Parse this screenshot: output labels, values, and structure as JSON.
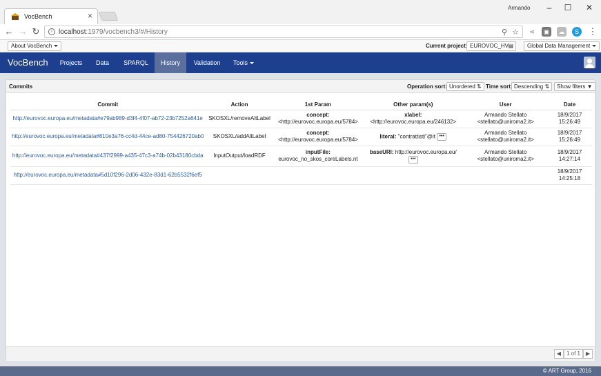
{
  "browser": {
    "tab_title": "VocBench",
    "user": "Armando",
    "url_host": "localhost",
    "url_rest": ":1979/vocbench3/#/History"
  },
  "vbbar": {
    "about": "About VocBench",
    "current_project_label": "Current project:",
    "current_project": "EUROVOC_HV",
    "global_data": "Global Data Management"
  },
  "nav": {
    "brand": "VocBench",
    "items": [
      "Projects",
      "Data",
      "SPARQL",
      "History",
      "Validation",
      "Tools"
    ],
    "active": "History"
  },
  "panel": {
    "title": "Commits",
    "operation_sort_label": "Operation sort:",
    "operation_sort": "Unordered",
    "time_sort_label": "Time sort:",
    "time_sort": "Descending",
    "show_filters": "Show filters"
  },
  "table": {
    "headers": [
      "Commit",
      "Action",
      "1st Param",
      "Other param(s)",
      "User",
      "Date"
    ],
    "rows": [
      {
        "commit": "http://eurovoc.europa.eu/metadata#e79ab989-d3f4-4f07-ab72-23b7252a641e",
        "action": "SKOSXL/removeAltLabel",
        "p1_key": "concept:",
        "p1_val": "<http://eurovoc.europa.eu/5784>",
        "op_key": "xlabel:",
        "op_val": "<http://eurovoc.europa.eu/246132>",
        "user_name": "Armando Stellato",
        "user_mail": "<stellato@uniroma2.it>",
        "date": "18/9/2017",
        "time": "15:26:49"
      },
      {
        "commit": "http://eurovoc.europa.eu/metadata#810e3a76-cc4d-44ce-ad80-754426720ab0",
        "action": "SKOSXL/addAltLabel",
        "p1_key": "concept:",
        "p1_val": "<http://eurovoc.europa.eu/5784>",
        "op_key": "literal:",
        "op_val": "\"contrattisti\"@it",
        "user_name": "Armando Stellato",
        "user_mail": "<stellato@uniroma2.it>",
        "date": "18/9/2017",
        "time": "15:26:49"
      },
      {
        "commit": "http://eurovoc.europa.eu/metadata#437f2999-a435-47c3-a74b-02b43180cbda",
        "action": "InputOutput/loadRDF",
        "p1_key": "inputFile:",
        "p1_val": "eurovoc_no_skos_coreLabels.nt",
        "op_key": "baseURI:",
        "op_val": "http://eurovoc.europa.eu/",
        "user_name": "Armando Stellato",
        "user_mail": "<stellato@uniroma2.it>",
        "date": "18/9/2017",
        "time": "14:27:14"
      },
      {
        "commit": "http://eurovoc.europa.eu/metadata#5d10f296-2d06-432e-83d1-62b5532f6ef5",
        "date": "18/9/2017",
        "time": "14:25:18"
      }
    ]
  },
  "pager": {
    "label": "1 of 1"
  },
  "footer": {
    "text": "© ART Group, 2016"
  }
}
